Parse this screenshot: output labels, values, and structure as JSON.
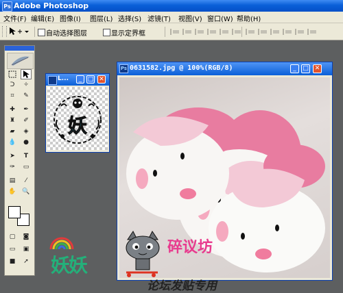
{
  "window": {
    "title": "Adobe Photoshop"
  },
  "menu": [
    "文件(F)",
    "编辑(E)",
    "图像(I)",
    "图层(L)",
    "选择(S)",
    "滤镜(T)",
    "视图(V)",
    "窗口(W)",
    "帮助(H)"
  ],
  "options": {
    "auto_select_label": "自动选择图层",
    "show_bounds_label": "显示定界框"
  },
  "layers_window": {
    "title": "L..."
  },
  "layer_thumb_text": "妖",
  "document": {
    "title": "0631582.jpg @ 100%(RGB/8)"
  },
  "watermark": {
    "left_text": "妖妖",
    "right_text": "碎议坊",
    "bottom_text": "论坛发贴专用"
  },
  "colors": {
    "titlebar": "#0a5fd8",
    "chrome": "#ece9d8",
    "workspace": "#5d5f60",
    "close_button": "#e1542d",
    "slipper_pink": "#e87ca0"
  }
}
